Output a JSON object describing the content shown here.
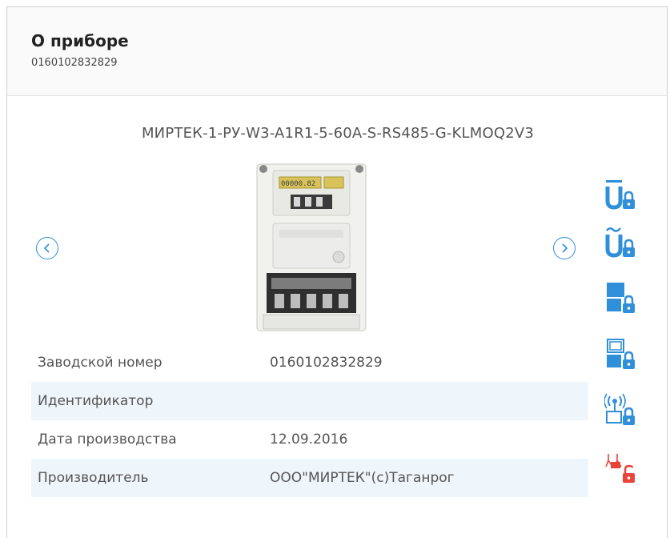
{
  "header": {
    "title": "О приборе",
    "subtitle": "0160102832829"
  },
  "device": {
    "model": "МИРТЕК-1-РУ-W3-A1R1-5-60A-S-RS485-G-KLMOQ2V3"
  },
  "info_rows": [
    {
      "label": "Заводской номер",
      "value": "0160102832829"
    },
    {
      "label": "Идентификатор",
      "value": ""
    },
    {
      "label": "Дата производства",
      "value": "12.09.2016"
    },
    {
      "label": "Производитель",
      "value": "ООО\"МИРТЕК\"(с)Таганрог"
    }
  ],
  "icons": {
    "prev": "chevron-left-icon",
    "next": "chevron-right-icon",
    "side": [
      "voltage-dc-lock-icon",
      "voltage-ac-lock-icon",
      "meter-lock-icon",
      "meter-lock-alt-icon",
      "wireless-lock-icon",
      "power-unlock-icon"
    ]
  },
  "colors": {
    "accent": "#2f8fd8",
    "alert": "#e8443a",
    "row_alt": "#eef5fb"
  }
}
